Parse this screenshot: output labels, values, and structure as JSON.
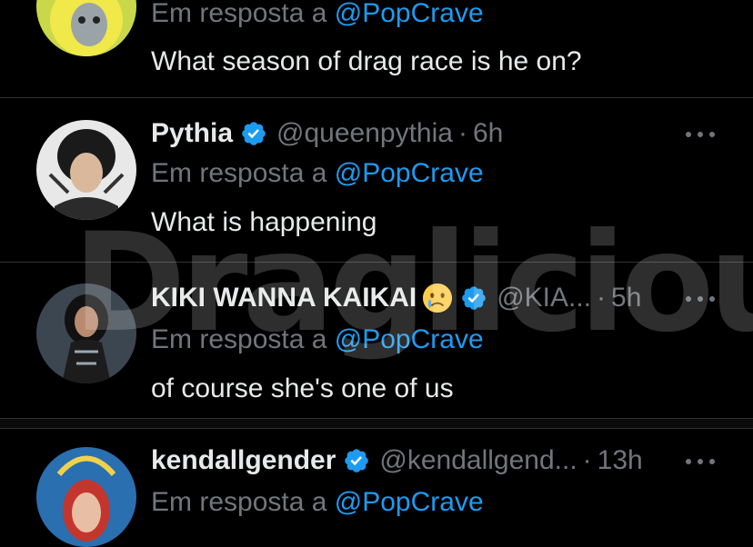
{
  "reply_prefix": "Em resposta a ",
  "reply_mention": "@PopCrave",
  "watermark": "Draglicious",
  "colors": {
    "background": "#000000",
    "text": "#e7e9ea",
    "muted": "#71767b",
    "link": "#1d9bf0",
    "verified": "#1d9bf0",
    "divider": "#2f3336"
  },
  "tweets": [
    {
      "text": "What season of drag race is he on?"
    },
    {
      "name": "Pythia",
      "handle": "@queenpythia",
      "time": "6h",
      "text": "What is happening",
      "verified": true,
      "avatar_icon": "drag-queen-avatar"
    },
    {
      "name": "KIKI WANNA KAIKAI",
      "emoji": "crying-face-emoji",
      "handle": "@KIA...",
      "time": "5h",
      "text": "of course she's one of us",
      "verified": true,
      "avatar_icon": "performer-avatar"
    },
    {
      "name": "kendallgender",
      "handle": "@kendallgend...",
      "time": "13h",
      "verified": true,
      "avatar_icon": "drag-queen-avatar"
    }
  ]
}
